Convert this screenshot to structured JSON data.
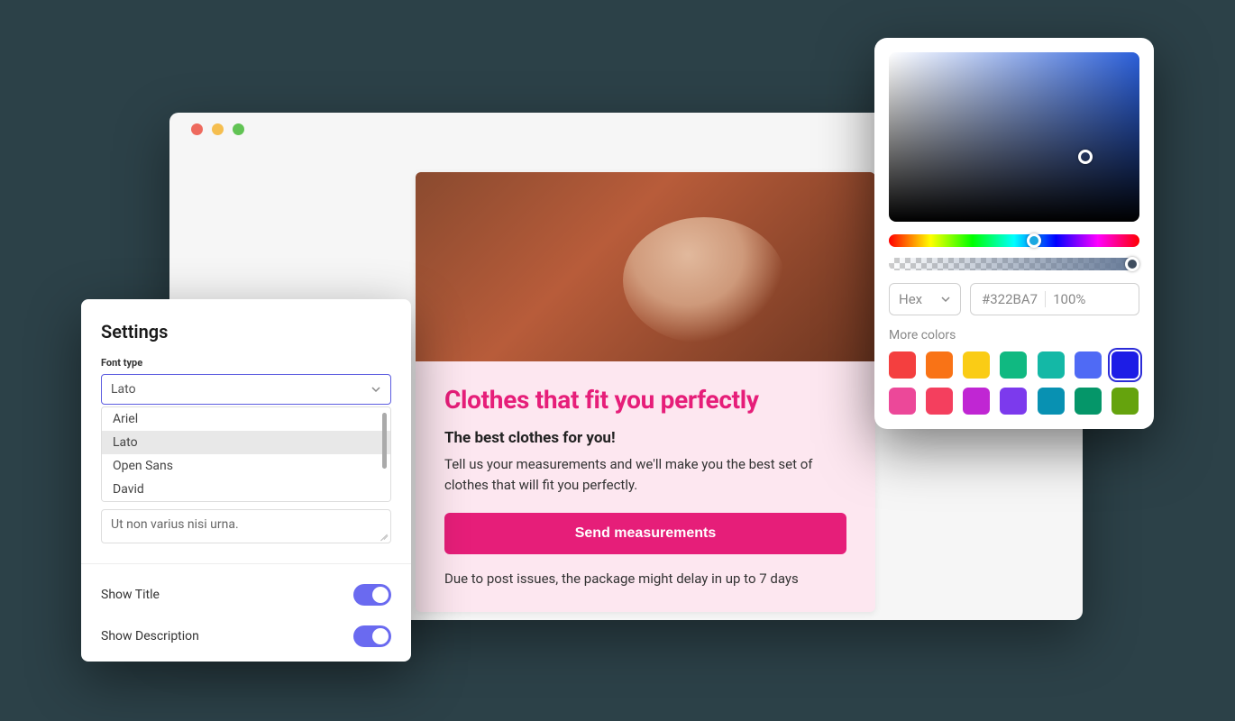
{
  "browser": {
    "promo": {
      "title": "Clothes that fit you perfectly",
      "subtitle": "The best clothes for you!",
      "body": "Tell us your measurements and we'll make you the best set of clothes that will fit you perfectly.",
      "cta": "Send measurements",
      "disclaimer": "Due to post issues, the package might delay in up to 7 days"
    }
  },
  "settings": {
    "title": "Settings",
    "font_type_label": "Font type",
    "font_selected": "Lato",
    "font_options": [
      "Ariel",
      "Lato",
      "Open Sans",
      "David"
    ],
    "font_hover_index": 1,
    "textarea_value": "Ut non varius nisi urna.",
    "toggles": [
      {
        "label": "Show Title",
        "value": true
      },
      {
        "label": "Show Description",
        "value": true
      }
    ]
  },
  "picker": {
    "mode": "Hex",
    "hex": "#322BA7",
    "alpha": "100%",
    "more_colors_label": "More colors",
    "selected_swatch_index": 6,
    "swatches": [
      "#f43f3f",
      "#f97316",
      "#facc15",
      "#10b981",
      "#14b8a6",
      "#4f6af5",
      "#1d1de6",
      "#ec4899",
      "#f43f5e",
      "#c026d3",
      "#7c3aed",
      "#0891b2",
      "#059669",
      "#65a30d"
    ]
  }
}
